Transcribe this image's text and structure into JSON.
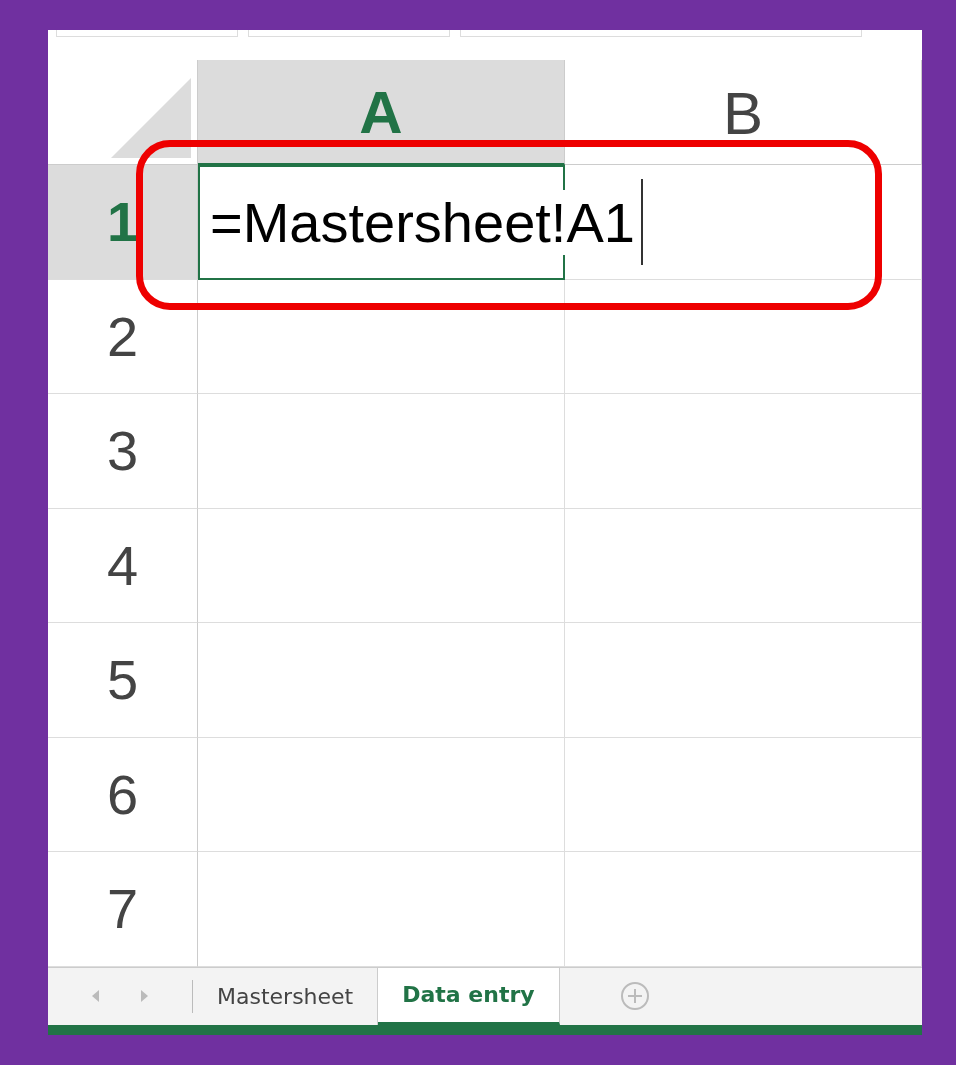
{
  "columns": [
    {
      "label": "A",
      "selected": true
    },
    {
      "label": "B",
      "selected": false
    }
  ],
  "rows": [
    {
      "label": "1",
      "selected": true
    },
    {
      "label": "2",
      "selected": false
    },
    {
      "label": "3",
      "selected": false
    },
    {
      "label": "4",
      "selected": false
    },
    {
      "label": "5",
      "selected": false
    },
    {
      "label": "6",
      "selected": false
    },
    {
      "label": "7",
      "selected": false
    }
  ],
  "active_cell": {
    "value": "=Mastersheet!A1",
    "editing": true
  },
  "sheet_tabs": [
    {
      "label": "Mastersheet",
      "selected": false
    },
    {
      "label": "Data entry",
      "selected": true
    }
  ]
}
